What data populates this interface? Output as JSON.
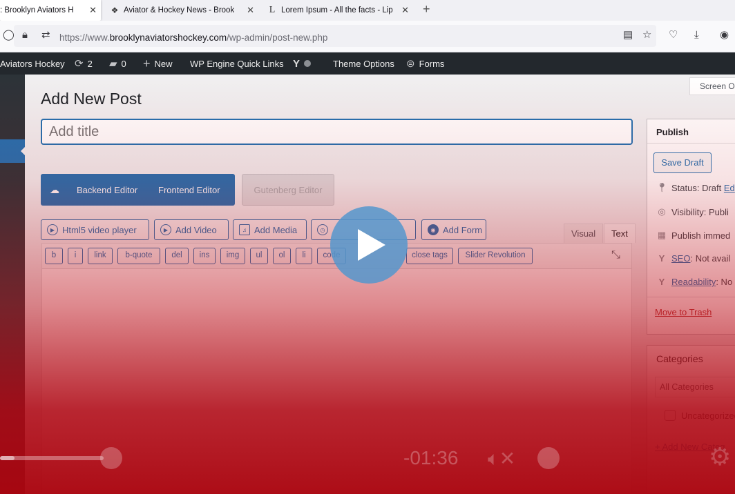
{
  "browser": {
    "tabs": [
      {
        "label": ": Brooklyn Aviators H",
        "active": true
      },
      {
        "label": "Aviator & Hockey News - Brook",
        "active": false
      },
      {
        "label": "Lorem Ipsum - All the facts - Lip",
        "active": false
      }
    ],
    "url_prefix": "https://www.",
    "url_domain": "brooklynaviatorshockey.com",
    "url_path": "/wp-admin/post-new.php"
  },
  "adminbar": {
    "site_name": "Aviators Hockey",
    "updates_count": "2",
    "comments_count": "0",
    "new_label": "New",
    "quicklinks_label": "WP Engine Quick Links",
    "theme_options_label": "Theme Options",
    "forms_label": "Forms"
  },
  "screen_options_label": "Screen O",
  "page_title": "Add New Post",
  "title_placeholder": "Add title",
  "editor_switch": {
    "backend_label": "Backend Editor",
    "frontend_label": "Frontend Editor",
    "gutenberg_label": "Gutenberg Editor"
  },
  "media_buttons": {
    "html5_label": "Html5 video player",
    "add_video_label": "Add Video",
    "add_media_label": "Add Media",
    "add_form_label": "Add Form"
  },
  "editor_tabs": {
    "visual": "Visual",
    "text": "Text"
  },
  "quicktags": [
    {
      "label": "b",
      "w": 26
    },
    {
      "label": "i",
      "w": 22
    },
    {
      "label": "link",
      "w": 36
    },
    {
      "label": "b-quote",
      "w": 62
    },
    {
      "label": "del",
      "w": 34
    },
    {
      "label": "ins",
      "w": 32
    },
    {
      "label": "img",
      "w": 36
    },
    {
      "label": "ul",
      "w": 26
    },
    {
      "label": "ol",
      "w": 26
    },
    {
      "label": "li",
      "w": 24
    },
    {
      "label": "code",
      "w": 42
    },
    {
      "label": "close tags",
      "w": 68
    },
    {
      "label": "Slider Revolution",
      "w": 108
    }
  ],
  "publish": {
    "title": "Publish",
    "save_draft_label": "Save Draft",
    "status_label": "Status: Draft",
    "status_edit": "Ed",
    "visibility_label": "Visibility: Publi",
    "publish_label": "Publish immed",
    "seo_link": "SEO",
    "seo_value": ": Not avail",
    "readability_link": "Readability",
    "readability_value": ": No",
    "trash_label": "Move to Trash"
  },
  "categories": {
    "title": "Categories",
    "tab_label": "All Categories",
    "item_label": "Uncategorized",
    "add_new_label": "+ Add New Categ"
  },
  "video": {
    "timecode": "-01:36",
    "progress": 0.14
  }
}
